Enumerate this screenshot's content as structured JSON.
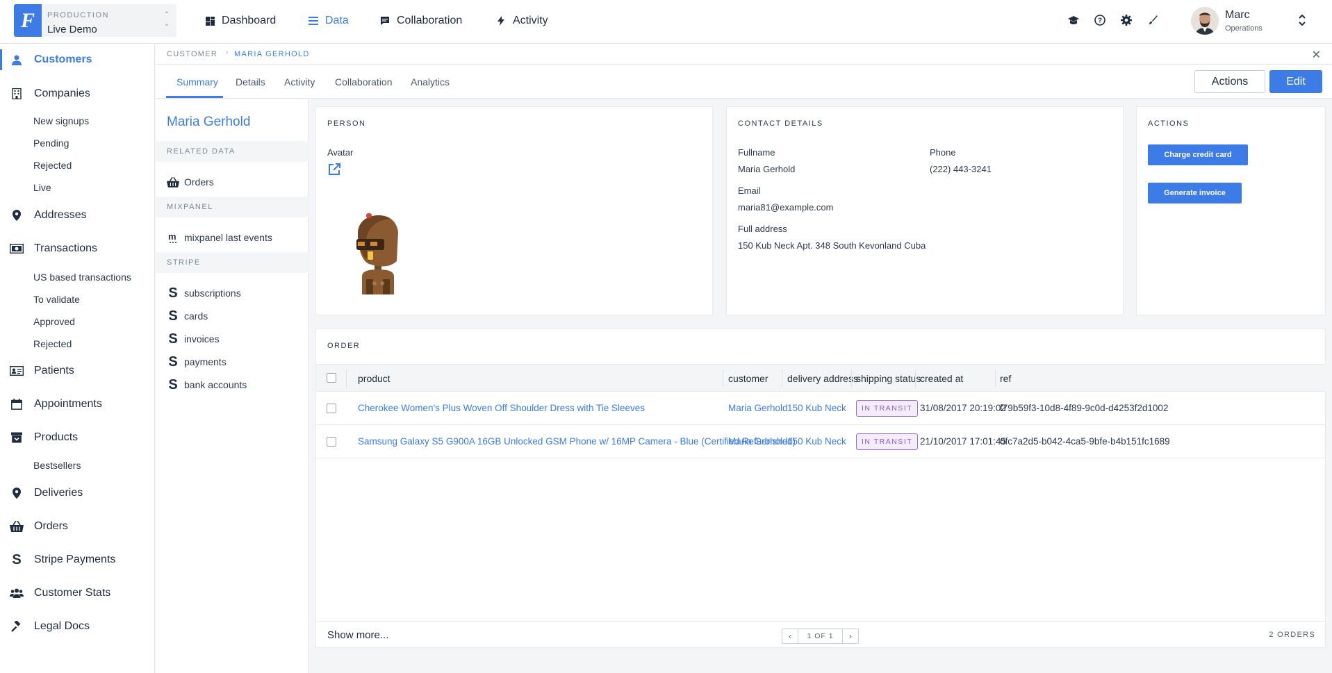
{
  "header": {
    "env_kicker": "PRODUCTION",
    "env_name": "Live Demo",
    "logo_letter": "F",
    "nav": [
      {
        "label": "Dashboard",
        "icon": "dashboard-icon"
      },
      {
        "label": "Data",
        "icon": "list-icon",
        "active": true
      },
      {
        "label": "Collaboration",
        "icon": "chat-icon"
      },
      {
        "label": "Activity",
        "icon": "bolt-icon"
      }
    ],
    "tool_icons": [
      "graduation-cap-icon",
      "help-icon",
      "gear-icon",
      "brush-icon"
    ],
    "user": {
      "name": "Marc",
      "role": "Operations"
    }
  },
  "sidebar": {
    "items": [
      {
        "label": "Customers",
        "icon": "user-icon",
        "active": true
      },
      {
        "label": "Companies",
        "icon": "building-icon"
      },
      {
        "label": "Addresses",
        "icon": "pin-icon"
      },
      {
        "label": "Transactions",
        "icon": "money-icon"
      },
      {
        "label": "Patients",
        "icon": "id-card-icon"
      },
      {
        "label": "Appointments",
        "icon": "calendar-icon"
      },
      {
        "label": "Products",
        "icon": "archive-icon"
      },
      {
        "label": "Deliveries",
        "icon": "pin-icon"
      },
      {
        "label": "Orders",
        "icon": "basket-icon"
      },
      {
        "label": "Stripe Payments",
        "icon": "stripe-icon"
      },
      {
        "label": "Customer Stats",
        "icon": "users-icon"
      },
      {
        "label": "Legal Docs",
        "icon": "gavel-icon"
      }
    ],
    "companies_sub": [
      "New signups",
      "Pending",
      "Rejected",
      "Live"
    ],
    "transactions_sub": [
      "US based transactions",
      "To validate",
      "Approved",
      "Rejected"
    ],
    "products_sub": [
      "Bestsellers"
    ]
  },
  "breadcrumb": {
    "root": "CUSTOMER",
    "current": "MARIA GERHOLD"
  },
  "tabs": [
    "Summary",
    "Details",
    "Activity",
    "Collaboration",
    "Analytics"
  ],
  "buttons": {
    "actions": "Actions",
    "edit": "Edit"
  },
  "related": {
    "title": "Maria Gerhold",
    "sections": [
      {
        "title": "RELATED DATA",
        "items": [
          {
            "label": "Orders",
            "icon": "basket-icon"
          }
        ]
      },
      {
        "title": "MIXPANEL",
        "items": [
          {
            "label": "mixpanel last events",
            "icon": "mixpanel-icon"
          }
        ]
      },
      {
        "title": "STRIPE",
        "items": [
          {
            "label": "subscriptions",
            "icon": "stripe-icon"
          },
          {
            "label": "cards",
            "icon": "stripe-icon"
          },
          {
            "label": "invoices",
            "icon": "stripe-icon"
          },
          {
            "label": "payments",
            "icon": "stripe-icon"
          },
          {
            "label": "bank accounts",
            "icon": "stripe-icon"
          }
        ]
      }
    ]
  },
  "person": {
    "title": "PERSON",
    "avatar_label": "Avatar"
  },
  "contact": {
    "title": "CONTACT DETAILS",
    "fullname_label": "Fullname",
    "fullname": "Maria Gerhold",
    "phone_label": "Phone",
    "phone": "(222) 443-3241",
    "email_label": "Email",
    "email": "maria81@example.com",
    "address_label": "Full address",
    "address": "150 Kub Neck Apt. 348 South Kevonland Cuba"
  },
  "actions_card": {
    "title": "ACTIONS",
    "charge": "Charge credit card",
    "invoice": "Generate invoice"
  },
  "orders": {
    "title": "ORDER",
    "columns": [
      "product",
      "customer",
      "delivery address",
      "shipping status",
      "created at",
      "ref"
    ],
    "rows": [
      {
        "product": "Cherokee Women's Plus Woven Off Shoulder Dress with Tie Sleeves",
        "customer": "Maria Gerhold",
        "delivery": "150 Kub Neck",
        "status": "IN TRANSIT",
        "created": "31/08/2017 20:19:02",
        "ref": "f79b59f3-10d8-4f89-9c0d-d4253f2d1002"
      },
      {
        "product": "Samsung Galaxy S5 G900A 16GB Unlocked GSM Phone w/ 16MP Camera - Blue (Certified Refurbished)",
        "customer": "Maria Gerhold",
        "delivery": "150 Kub Neck",
        "status": "IN TRANSIT",
        "created": "21/10/2017 17:01:45",
        "ref": "0fc7a2d5-b042-4ca5-9bfe-b4b151fc1689"
      }
    ],
    "show_more": "Show more...",
    "pagination": "1 OF 1",
    "count": "2 ORDERS"
  },
  "colors": {
    "accent": "#3d7be6",
    "status_transit": "#8c5bc8"
  }
}
